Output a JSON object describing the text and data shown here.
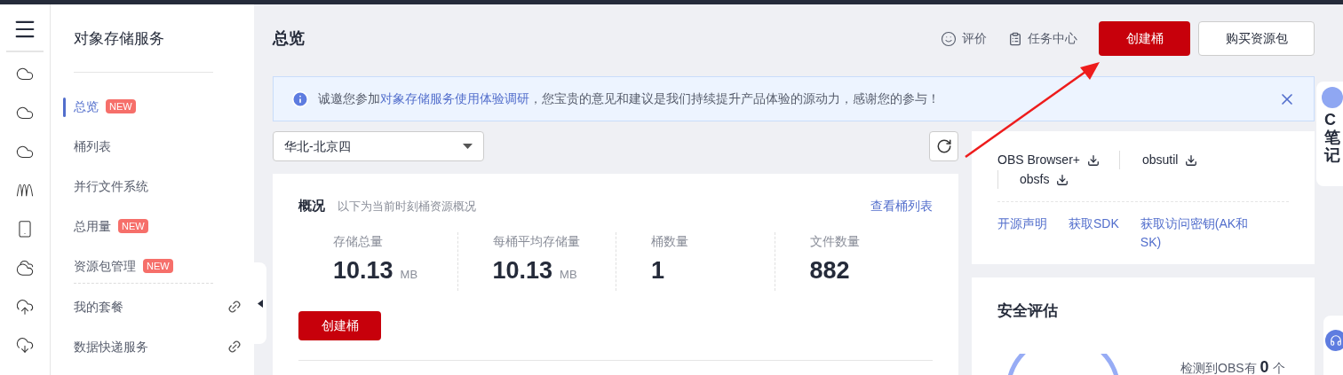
{
  "sidebar": {
    "title": "对象存储服务",
    "items": [
      {
        "label": "总览",
        "badge": "NEW",
        "selected": true,
        "kind": "page"
      },
      {
        "label": "桶列表",
        "selected": false,
        "kind": "page"
      },
      {
        "label": "并行文件系统",
        "selected": false,
        "kind": "page"
      },
      {
        "label": "总用量",
        "badge": "NEW",
        "selected": false,
        "kind": "page"
      },
      {
        "label": "资源包管理",
        "badge": "NEW",
        "selected": false,
        "kind": "page"
      },
      {
        "label": "我的套餐",
        "selected": false,
        "kind": "link"
      },
      {
        "label": "数据快递服务",
        "selected": false,
        "kind": "link"
      }
    ]
  },
  "header": {
    "title": "总览",
    "actions": [
      {
        "label": "评价",
        "kind": "feedback"
      },
      {
        "label": "任务中心",
        "kind": "tasks"
      }
    ],
    "buttons": [
      {
        "label": "创建桶",
        "kind": "primary"
      },
      {
        "label": "购买资源包",
        "kind": "secondary"
      }
    ]
  },
  "banner": {
    "text": "诚邀您参加",
    "link": "对象存储服务使用体验调研",
    "text_after": "，您宝贵的意见和建议是我们持续提升产品体验的源动力，感谢您的参与！"
  },
  "region_select": {
    "value": "华北-北京四"
  },
  "overview": {
    "title": "概况",
    "subtitle": "以下为当前时刻桶资源概况",
    "link": "查看桶列表",
    "stats": [
      {
        "label": "存储总量",
        "value": "10.13",
        "unit": "MB"
      },
      {
        "label": "每桶平均存储量",
        "value": "10.13",
        "unit": "MB"
      },
      {
        "label": "桶数量",
        "value": "1"
      },
      {
        "label": "文件数量",
        "value": "882"
      }
    ],
    "button": "创建桶"
  },
  "tools": {
    "downloads": [
      "OBS Browser+",
      "obsutil",
      "obsfs"
    ],
    "links": [
      "开源声明",
      "获取SDK",
      "获取访问密钥(AK和SK)"
    ]
  },
  "security": {
    "title": "安全评估",
    "detected": "检测到OBS有",
    "count": "0",
    "unit": "个"
  },
  "side_widget": {
    "label": "C笔记"
  }
}
